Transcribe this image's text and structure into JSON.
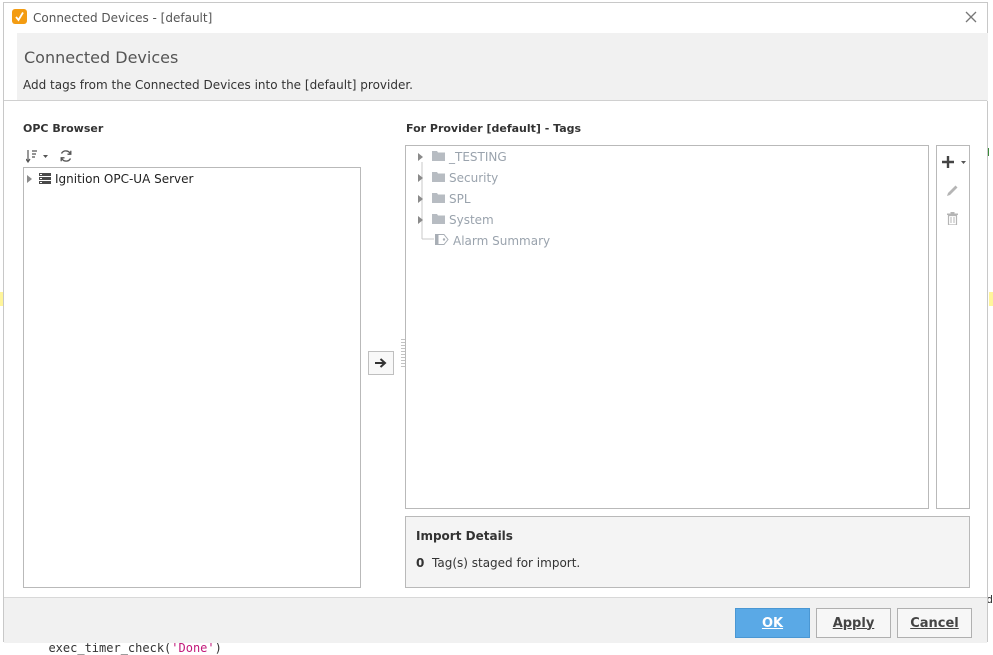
{
  "window": {
    "title": "Connected Devices - [default]"
  },
  "header": {
    "title": "Connected Devices",
    "subtitle": "Add tags from the Connected Devices into the [default] provider."
  },
  "opc_browser": {
    "label": "OPC Browser",
    "tree": [
      {
        "label": "Ignition OPC-UA Server",
        "icon": "server-icon"
      }
    ]
  },
  "provider_tags": {
    "label": "For Provider [default] - Tags",
    "tree": [
      {
        "label": "_TESTING",
        "icon": "folder-icon",
        "expandable": true
      },
      {
        "label": "Security",
        "icon": "folder-icon",
        "expandable": true
      },
      {
        "label": "SPL",
        "icon": "folder-icon",
        "expandable": true
      },
      {
        "label": "System",
        "icon": "folder-icon",
        "expandable": true
      },
      {
        "label": "Alarm Summary",
        "icon": "tag-icon",
        "expandable": false
      }
    ]
  },
  "import_details": {
    "title": "Import Details",
    "count": "0",
    "text": "Tag(s) staged for import."
  },
  "buttons": {
    "ok": "OK",
    "apply": "Apply",
    "cancel": "Cancel"
  },
  "background": {
    "code_prefix": "  exec_timer_check(",
    "code_string": "'Done'",
    "code_suffix": ")",
    "right_char": "d"
  },
  "colors": {
    "accent": "#5aa9e6",
    "app_icon": "#f39c12",
    "faded_text": "#9aa3ad"
  }
}
